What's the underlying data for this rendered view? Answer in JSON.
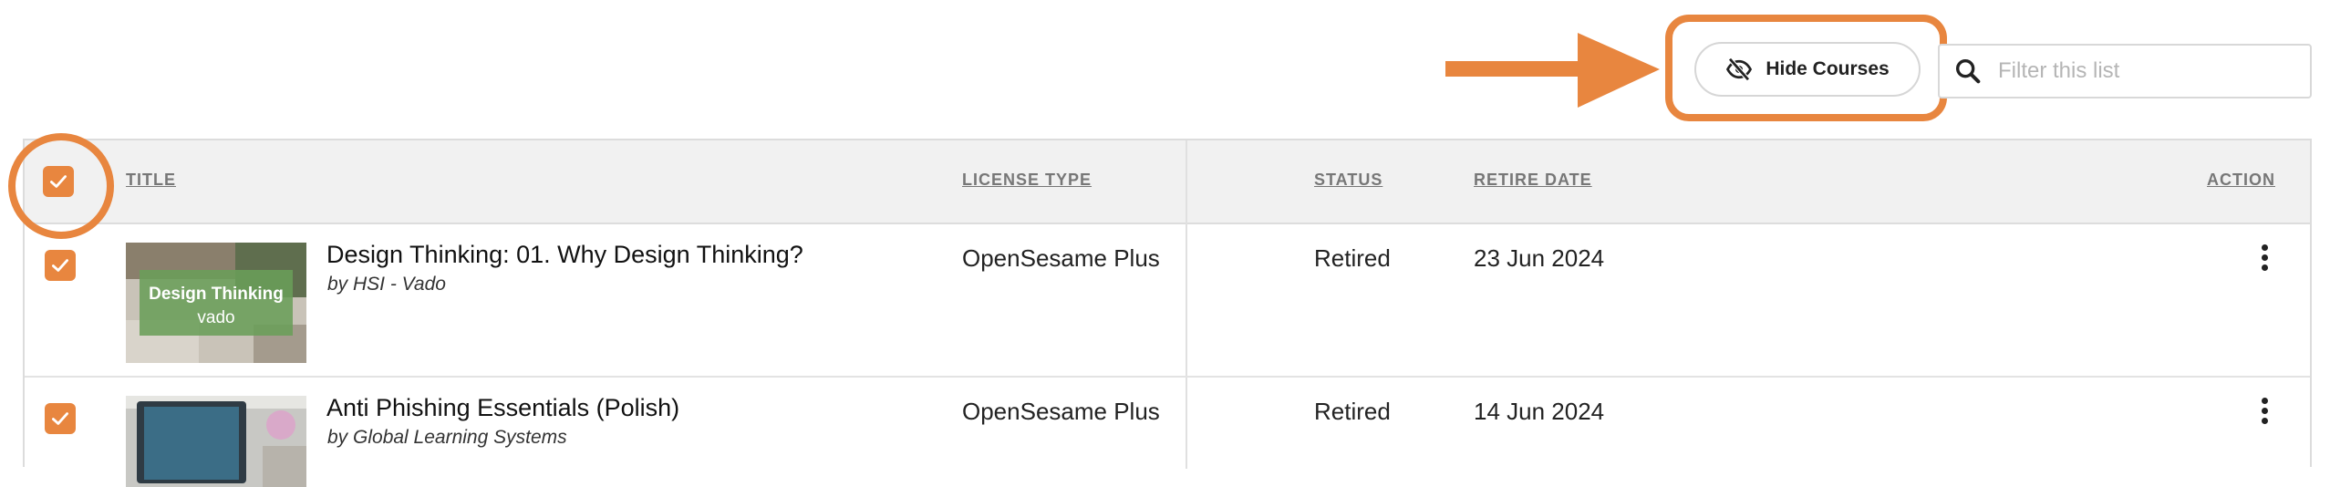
{
  "toolbar": {
    "hide_courses_label": "Hide Courses",
    "filter_placeholder": "Filter this list",
    "hide_icon": "eye-slash-icon",
    "search_icon": "search-icon"
  },
  "table": {
    "headers": {
      "title": "TITLE",
      "license_type": "LICENSE TYPE",
      "status": "STATUS",
      "retire_date": "RETIRE DATE",
      "action": "ACTION"
    },
    "select_all_checked": true,
    "rows": [
      {
        "checked": true,
        "title": "Design Thinking: 01. Why Design Thinking?",
        "author": "by HSI - Vado",
        "thumbnail_line1": "Design Thinking",
        "thumbnail_line2": "vado",
        "license_type": "OpenSesame Plus",
        "status": "Retired",
        "retire_date": "23 Jun 2024"
      },
      {
        "checked": true,
        "title": "Anti Phishing Essentials (Polish)",
        "author": "by Global Learning Systems",
        "license_type": "OpenSesame Plus",
        "status": "Retired",
        "retire_date": "14 Jun 2024"
      }
    ]
  },
  "colors": {
    "accent": "#e8863f",
    "header_bg": "#f1f1f1",
    "header_text": "#777777"
  }
}
